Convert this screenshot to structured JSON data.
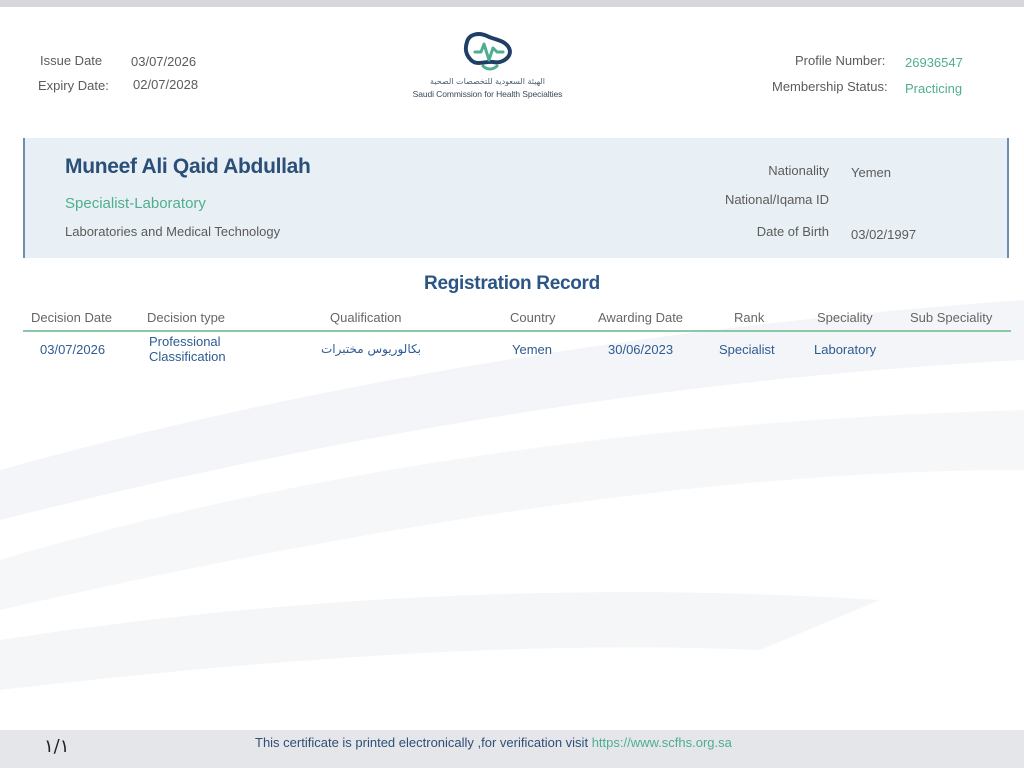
{
  "header": {
    "issue_date_label": "Issue Date",
    "issue_date": "03/07/2026",
    "expiry_date_label": "Expiry Date:",
    "expiry_date": "02/07/2028",
    "profile_number_label": "Profile Number:",
    "profile_number": "26936547",
    "membership_status_label": "Membership Status:",
    "membership_status": "Practicing"
  },
  "logo": {
    "arabic_name": "الهيئة السعودية للتخصصات الصحية",
    "english_name": "Saudi Commission for Health Specialties",
    "icon": "scfhs-logo-icon"
  },
  "profile": {
    "name": "Muneef Ali Qaid Abdullah",
    "specialty": "Specialist-Laboratory",
    "department": "Laboratories and Medical Technology",
    "nationality_label": "Nationality",
    "nationality": "Yemen",
    "national_id_label": "National/Iqama ID",
    "national_id": "",
    "dob_label": "Date of Birth",
    "dob": "03/02/1997"
  },
  "registration": {
    "title": "Registration Record",
    "columns": [
      "Decision Date",
      "Decision type",
      "Qualification",
      "Country",
      "Awarding Date",
      "Rank",
      "Speciality",
      "Sub Speciality"
    ],
    "rows": [
      {
        "decision_date": "03/07/2026",
        "decision_type_line1": "Professional",
        "decision_type_line2": "Classification",
        "qualification": "بكالوريوس مختبرات",
        "country": "Yemen",
        "awarding_date": "30/06/2023",
        "rank": "Specialist",
        "speciality": "Laboratory",
        "sub_speciality": ""
      }
    ]
  },
  "footer": {
    "page_number": "١/١",
    "text": "This certificate is printed electronically ,for verification visit ",
    "link": "https://www.scfhs.org.sa"
  },
  "colors": {
    "accent_green": "#4fae8f",
    "title_blue": "#2b5585",
    "box_bg": "#e9f0f5"
  }
}
